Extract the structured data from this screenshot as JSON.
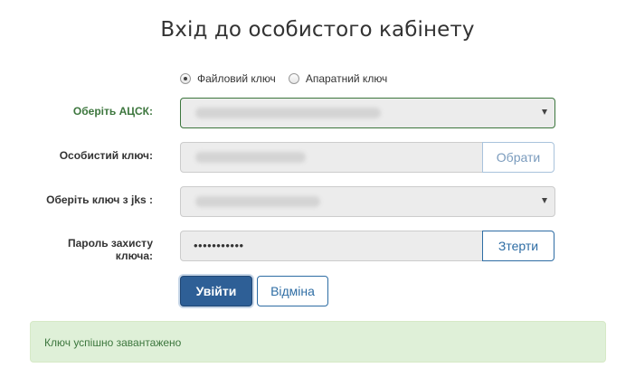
{
  "page": {
    "title": "Вхід до особистого кабінету"
  },
  "key_type": {
    "options": [
      {
        "label": "Файловий ключ",
        "selected": true
      },
      {
        "label": "Апаратний ключ",
        "selected": false
      }
    ]
  },
  "form": {
    "acsk_label": "Оберіть АЦСК:",
    "private_key_label": "Особистий ключ:",
    "choose_button": "Обрати",
    "jks_label": "Оберіть ключ з jks :",
    "password_label_line1": "Пароль захисту",
    "password_label_line2": "ключа:",
    "password_value": "•••••••••••",
    "clear_button": "Зтерти"
  },
  "actions": {
    "login": "Увійти",
    "cancel": "Відміна"
  },
  "status": {
    "message": "Ключ успішно завантажено"
  },
  "colors": {
    "primary": "#2e5f96",
    "success_bg": "#dff0d8",
    "success_text": "#3c763d"
  },
  "icons": {
    "select_caret": "caret-down-icon",
    "radio_checked": "radio-checked-icon",
    "radio_unchecked": "radio-unchecked-icon"
  }
}
